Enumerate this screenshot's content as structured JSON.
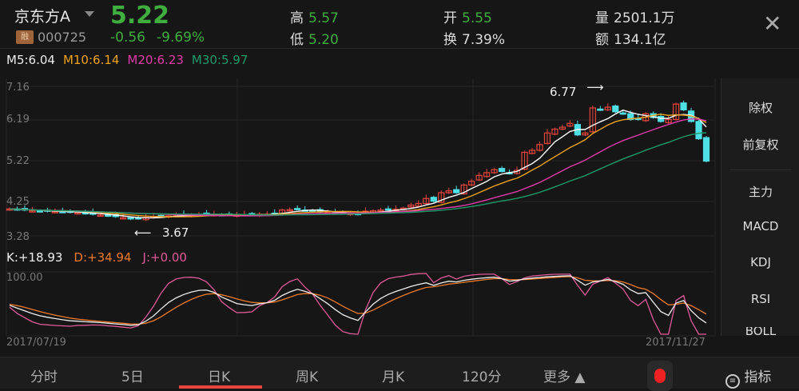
{
  "header": {
    "name": "京东方A",
    "badge": "融",
    "code": "000725",
    "price": "5.22",
    "change": "-0.56",
    "change_pct": "-9.69%",
    "high_label": "高",
    "high": "5.57",
    "low_label": "低",
    "low": "5.20",
    "open_label": "开",
    "open": "5.55",
    "turnover_label": "换",
    "turnover": "7.39%",
    "volume_label": "量",
    "volume": "2501.1万",
    "amount_label": "额",
    "amount": "134.1亿",
    "close_icon": "close-icon"
  },
  "ma": {
    "m5": "M5:6.04",
    "m10": "M10:6.14",
    "m20": "M20:6.23",
    "m30": "M30:5.97"
  },
  "kdj": {
    "k": "K:+18.93",
    "d": "D:+34.94",
    "j": "J:+0.00",
    "top": "100.00"
  },
  "axis": {
    "y": [
      "7.16",
      "6.19",
      "5.22",
      "4.25",
      "3.28"
    ],
    "start_date": "2017/07/19",
    "end_date": "2017/11/27",
    "max_label": "6.77",
    "min_label": "3.67"
  },
  "side": {
    "items": [
      "除权",
      "前复权",
      "主力",
      "MACD",
      "KDJ",
      "RSI",
      "BOLL"
    ],
    "active": [
      "前复权",
      "KDJ"
    ]
  },
  "tabs": {
    "items": [
      "分时",
      "5日",
      "日K",
      "周K",
      "月K",
      "120分",
      "更多 ▲"
    ],
    "active": "日K",
    "indicator": "指标"
  },
  "colors": {
    "up": "#e8453c",
    "down": "#4fe0e6",
    "m5": "#ffffff",
    "m10": "#f0a21c",
    "m20": "#e03aa8",
    "m30": "#1e9a6a",
    "green": "#3fae3f"
  },
  "chart_data": {
    "type": "candlestick",
    "ylim": [
      3.28,
      7.16
    ],
    "closes": [
      3.98,
      3.96,
      3.95,
      3.93,
      3.92,
      3.92,
      3.91,
      3.9,
      3.89,
      3.88,
      3.86,
      3.84,
      3.82,
      3.8,
      3.78,
      3.75,
      3.72,
      3.73,
      3.76,
      3.78,
      3.8,
      3.8,
      3.81,
      3.82,
      3.83,
      3.84,
      3.84,
      3.83,
      3.82,
      3.82,
      3.82,
      3.83,
      3.83,
      3.84,
      3.84,
      3.86,
      3.95,
      3.96,
      3.98,
      3.94,
      3.93,
      3.9,
      3.88,
      3.87,
      3.86,
      3.86,
      3.84,
      3.92,
      3.93,
      3.95,
      3.96,
      3.97,
      4.0,
      4.08,
      4.12,
      4.25,
      4.18,
      4.4,
      4.45,
      4.4,
      4.6,
      4.7,
      4.85,
      4.92,
      5.0,
      4.95,
      4.9,
      4.98,
      5.45,
      5.5,
      5.65,
      5.95,
      6.05,
      6.1,
      6.2,
      5.9,
      5.95,
      6.6,
      6.55,
      6.62,
      6.5,
      6.45,
      6.3,
      6.3,
      6.45,
      6.35,
      6.25,
      6.3,
      6.7,
      6.55,
      6.25,
      5.8,
      5.22
    ]
  }
}
